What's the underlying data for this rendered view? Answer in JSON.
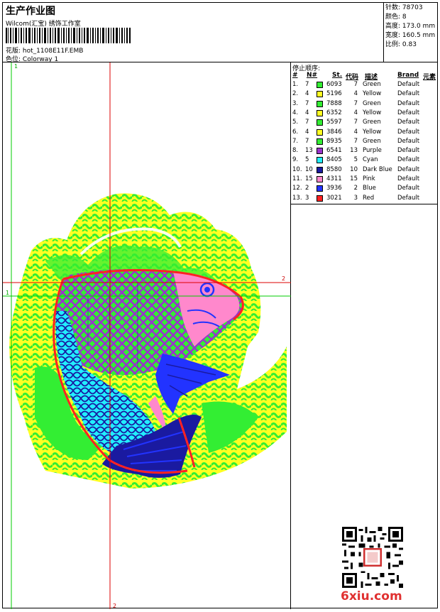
{
  "header": {
    "title": "生产作业图",
    "subtitle": "Wilcom(汇宝) 绣饰工作室",
    "design_label": "花版:",
    "design_value": "hot_1108E11F.EMB",
    "colorway_label": "色位:",
    "colorway_value": "Colorway 1"
  },
  "stats": [
    {
      "label": "针数:",
      "value": "78703"
    },
    {
      "label": "颜色:",
      "value": "8"
    },
    {
      "label": "高度:",
      "value": "173.0 mm"
    },
    {
      "label": "宽度:",
      "value": "160.5 mm"
    },
    {
      "label": "比例:",
      "value": "0.83"
    }
  ],
  "sequence": {
    "title": "停止顺序:",
    "headers": [
      "#",
      "N#",
      "St.",
      "代码",
      "描述",
      "Brand",
      "元素"
    ],
    "rows": [
      {
        "idx": "1.",
        "n": "7",
        "color": "#33ee33",
        "st": "6093",
        "code": "7",
        "desc": "Green",
        "brand": "Default"
      },
      {
        "idx": "2.",
        "n": "4",
        "color": "#ffff22",
        "st": "5196",
        "code": "4",
        "desc": "Yellow",
        "brand": "Default"
      },
      {
        "idx": "3.",
        "n": "7",
        "color": "#33ee33",
        "st": "7888",
        "code": "7",
        "desc": "Green",
        "brand": "Default"
      },
      {
        "idx": "4.",
        "n": "4",
        "color": "#ffff22",
        "st": "6352",
        "code": "4",
        "desc": "Yellow",
        "brand": "Default"
      },
      {
        "idx": "5.",
        "n": "7",
        "color": "#33ee33",
        "st": "5597",
        "code": "7",
        "desc": "Green",
        "brand": "Default"
      },
      {
        "idx": "6.",
        "n": "4",
        "color": "#ffff22",
        "st": "3846",
        "code": "4",
        "desc": "Yellow",
        "brand": "Default"
      },
      {
        "idx": "7.",
        "n": "7",
        "color": "#33ee33",
        "st": "8935",
        "code": "7",
        "desc": "Green",
        "brand": "Default"
      },
      {
        "idx": "8.",
        "n": "13",
        "color": "#9933cc",
        "st": "6541",
        "code": "13",
        "desc": "Purple",
        "brand": "Default"
      },
      {
        "idx": "9.",
        "n": "5",
        "color": "#22eeff",
        "st": "8405",
        "code": "5",
        "desc": "Cyan",
        "brand": "Default"
      },
      {
        "idx": "10.",
        "n": "10",
        "color": "#1a1aa0",
        "st": "8580",
        "code": "10",
        "desc": "Dark Blue",
        "brand": "Default"
      },
      {
        "idx": "11.",
        "n": "15",
        "color": "#ff88cc",
        "st": "4311",
        "code": "15",
        "desc": "Pink",
        "brand": "Default"
      },
      {
        "idx": "12.",
        "n": "2",
        "color": "#2233ff",
        "st": "3936",
        "code": "2",
        "desc": "Blue",
        "brand": "Default"
      },
      {
        "idx": "13.",
        "n": "3",
        "color": "#ff2222",
        "st": "3021",
        "code": "3",
        "desc": "Red",
        "brand": "Default"
      }
    ]
  },
  "canvas": {
    "guide_label_v_green": "1",
    "guide_label_h_green": "1",
    "guide_label_v_red": "2",
    "guide_label_h_red": "2",
    "colors": {
      "guide_green": "#00cc00",
      "guide_red": "#dd0000"
    }
  },
  "watermark": "6xiu.com"
}
